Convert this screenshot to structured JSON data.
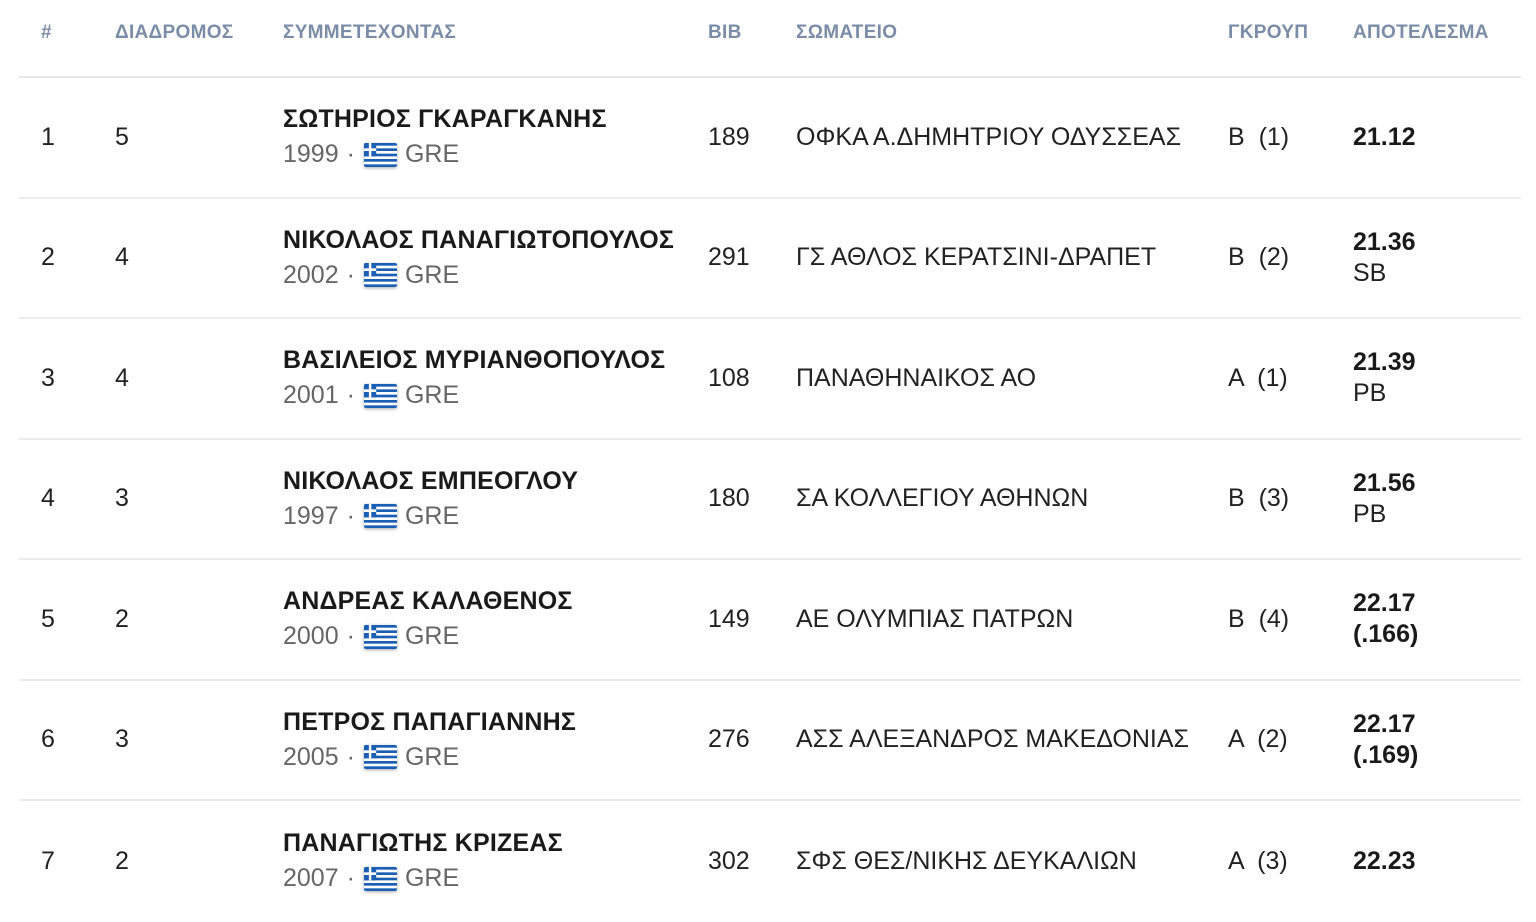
{
  "header": {
    "rank": "#",
    "lane": "ΔΙΑΔΡΟΜΟΣ",
    "athlete": "ΣΥΜΜΕΤΕΧΟΝΤΑΣ",
    "bib": "BIB",
    "club": "ΣΩΜΑΤΕΙΟ",
    "group": "ΓΚΡΟΥΠ",
    "result": "ΑΠΟΤΕΛΕΣΜΑ"
  },
  "flag_colors": {
    "blue": "#1a5fb4",
    "white": "#ffffff"
  },
  "rows": [
    {
      "rank": "1",
      "lane": "5",
      "name": "ΣΩΤΗΡΙΟΣ ΓΚΑΡΑΓΚΑΝΗΣ",
      "year": "1999",
      "separator": "·",
      "flag_icon": "greece-flag-icon",
      "nationality": "GRE",
      "bib": "189",
      "club": "ΟΦΚΑ Α.ΔΗΜΗΤΡΙΟΥ ΟΔΥΣΣΕΑΣ",
      "group": "Β  (1)",
      "result": "21.12",
      "note": ""
    },
    {
      "rank": "2",
      "lane": "4",
      "name": "ΝΙΚΟΛΑΟΣ ΠΑΝΑΓΙΩΤΟΠΟΥΛΟΣ",
      "year": "2002",
      "separator": "·",
      "flag_icon": "greece-flag-icon",
      "nationality": "GRE",
      "bib": "291",
      "club": "ΓΣ ΑΘΛΟΣ ΚΕΡΑΤΣΙΝΙ-ΔΡΑΠΕΤ",
      "group": "Β  (2)",
      "result": "21.36",
      "note": "SB"
    },
    {
      "rank": "3",
      "lane": "4",
      "name": "ΒΑΣΙΛΕΙΟΣ ΜΥΡΙΑΝΘΟΠΟΥΛΟΣ",
      "year": "2001",
      "separator": "·",
      "flag_icon": "greece-flag-icon",
      "nationality": "GRE",
      "bib": "108",
      "club": "ΠΑΝΑΘΗΝΑΙΚΟΣ ΑΟ",
      "group": "Α  (1)",
      "result": "21.39",
      "note": "PB"
    },
    {
      "rank": "4",
      "lane": "3",
      "name": "ΝΙΚΟΛΑΟΣ ΕΜΠΕΟΓΛΟΥ",
      "year": "1997",
      "separator": "·",
      "flag_icon": "greece-flag-icon",
      "nationality": "GRE",
      "bib": "180",
      "club": "ΣΑ ΚΟΛΛΕΓΙΟΥ ΑΘΗΝΩΝ",
      "group": "Β  (3)",
      "result": "21.56",
      "note": "PB"
    },
    {
      "rank": "5",
      "lane": "2",
      "name": "ΑΝΔΡΕΑΣ ΚΑΛΑΘΕΝΟΣ",
      "year": "2000",
      "separator": "·",
      "flag_icon": "greece-flag-icon",
      "nationality": "GRE",
      "bib": "149",
      "club": "ΑΕ ΟΛΥΜΠΙΑΣ ΠΑΤΡΩΝ",
      "group": "Β  (4)",
      "result": "22.17",
      "note": "(.166)"
    },
    {
      "rank": "6",
      "lane": "3",
      "name": "ΠΕΤΡΟΣ ΠΑΠΑΓΙΑΝΝΗΣ",
      "year": "2005",
      "separator": "·",
      "flag_icon": "greece-flag-icon",
      "nationality": "GRE",
      "bib": "276",
      "club": "ΑΣΣ ΑΛΕΞΑΝΔΡΟΣ ΜΑΚΕΔΟΝΙΑΣ",
      "group": "Α  (2)",
      "result": "22.17",
      "note": "(.169)"
    },
    {
      "rank": "7",
      "lane": "2",
      "name": "ΠΑΝΑΓΙΩΤΗΣ ΚΡΙΖΕΑΣ",
      "year": "2007",
      "separator": "·",
      "flag_icon": "greece-flag-icon",
      "nationality": "GRE",
      "bib": "302",
      "club": "ΣΦΣ ΘΕΣ/ΝΙΚΗΣ ΔΕΥΚΑΛΙΩΝ",
      "group": "Α  (3)",
      "result": "22.23",
      "note": ""
    }
  ]
}
